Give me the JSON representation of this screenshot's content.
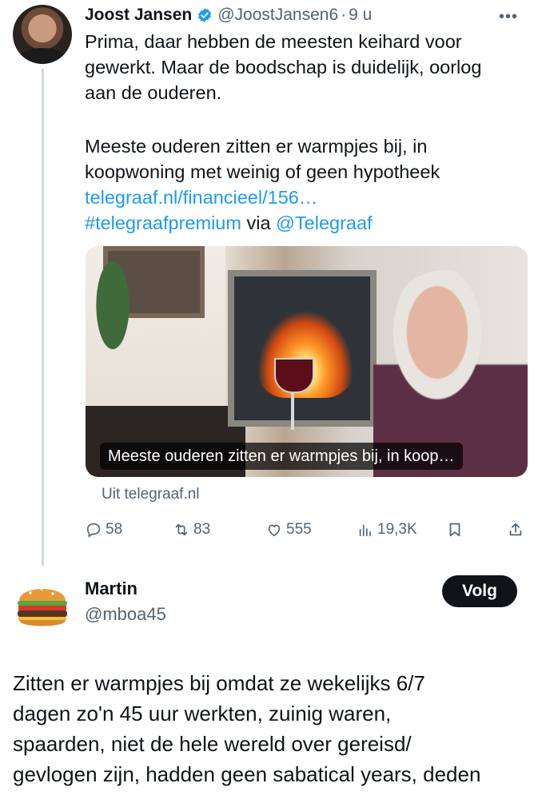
{
  "tweet1": {
    "name": "Joost Jansen",
    "handle": "@JoostJansen6",
    "separator": "·",
    "time": "9 u",
    "text": "Prima, daar hebben de meesten keihard voor\ngewerkt. Maar de boodschap is duidelijk, oorlog\naan de ouderen.",
    "text2": "Meeste ouderen zitten er warmpjes bij, in\nkoopwoning met weinig of geen hypotheek",
    "link_url": "telegraaf.nl/financieel/156…",
    "hashtag": "#telegraafpremium",
    "via_word": "via",
    "mention": "@Telegraaf",
    "card": {
      "caption": "Meeste ouderen zitten er warmpjes bij, in koop…",
      "source": "Uit telegraaf.nl"
    },
    "actions": {
      "replies": "58",
      "retweets": "83",
      "likes": "555",
      "views": "19,3K"
    }
  },
  "tweet2": {
    "name": "Martin",
    "handle": "@mboa45",
    "follow_label": "Volg",
    "text": "Zitten er warmpjes bij omdat ze wekelijks 6/7\ndagen zo'n 45 uur werkten, zuinig waren,\nspaarden, niet de hele wereld over gereisd/\ngevlogen zijn, hadden geen sabatical years, deden"
  },
  "colors": {
    "accent": "#1d9bf0",
    "text": "#0f1419",
    "muted": "#536471",
    "thread_line": "#cfd9de"
  },
  "icons": [
    "verified-badge-icon",
    "more-icon",
    "reply-icon",
    "retweet-icon",
    "like-icon",
    "views-icon",
    "bookmark-icon",
    "share-icon"
  ]
}
